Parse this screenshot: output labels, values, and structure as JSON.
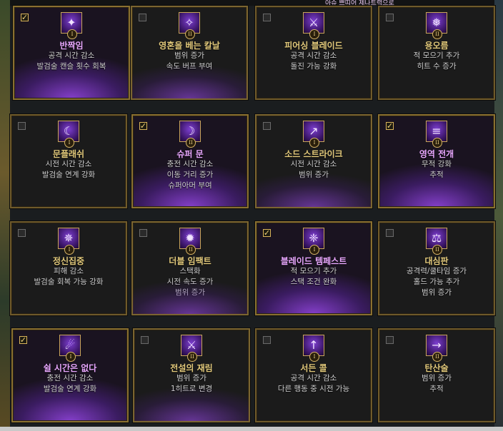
{
  "header_note": "아슈 쁘띠어 제나트력으로",
  "cards": [
    {
      "title": "반짝임",
      "lines": [
        "공격 시간 감소",
        "발검술 캔슬 횟수 회복"
      ],
      "checked": true,
      "rank": "I",
      "icon": "sparkle-icon"
    },
    {
      "title": "영혼을 베는 칼날",
      "lines": [
        "범위 증가",
        "속도 버프 부여"
      ],
      "checked": false,
      "rank": "II",
      "icon": "soul-blade-icon"
    },
    {
      "title": "피어싱 블레이드",
      "lines": [
        "공격 시간 감소",
        "돌진 가능 강화"
      ],
      "checked": false,
      "rank": "I",
      "icon": "piercing-blade-icon"
    },
    {
      "title": "용오름",
      "lines": [
        "적 모으기 추가",
        "히트 수 증가"
      ],
      "checked": false,
      "rank": "II",
      "icon": "tornado-icon"
    },
    {
      "title": "문플래쉬",
      "lines": [
        "시전 시간 감소",
        "발검술 연계 강화"
      ],
      "checked": false,
      "rank": "I",
      "icon": "moon-icon"
    },
    {
      "title": "슈퍼 문",
      "lines": [
        "충전 시간 감소",
        "이동 거리 증가",
        "슈퍼아머 부여"
      ],
      "checked": true,
      "rank": "II",
      "icon": "super-moon-icon"
    },
    {
      "title": "소드 스트라이크",
      "lines": [
        "시전 시간 감소",
        "범위 증가"
      ],
      "checked": false,
      "rank": "I",
      "icon": "sword-strike-icon"
    },
    {
      "title": "영역 전개",
      "lines": [
        "무적 강화",
        "추적"
      ],
      "checked": true,
      "rank": "II",
      "icon": "domain-icon"
    },
    {
      "title": "정신집중",
      "lines": [
        "피해 감소",
        "발검술 회복 가능 강화"
      ],
      "checked": false,
      "rank": "I",
      "icon": "focus-icon"
    },
    {
      "title": "더블 임팩트",
      "lines": [
        "스택화",
        "시전 속도 증가",
        "범위 증가"
      ],
      "checked": false,
      "rank": "II",
      "icon": "double-impact-icon"
    },
    {
      "title": "블레이드 템페스트",
      "lines": [
        "적 모으기 추가",
        "스택 조건 완화"
      ],
      "checked": true,
      "rank": "I",
      "icon": "tempest-icon"
    },
    {
      "title": "대심판",
      "lines": [
        "공격력/쿨타임 증가",
        "홀드 가능 추가",
        "범위 증가"
      ],
      "checked": false,
      "rank": "II",
      "icon": "judgment-icon"
    },
    {
      "title": "쉴 시간은 없다",
      "lines": [
        "충전 시간 감소",
        "발검술 연계 강화"
      ],
      "checked": true,
      "rank": "I",
      "icon": "no-rest-icon"
    },
    {
      "title": "전설의 재림",
      "lines": [
        "범위 증가",
        "1히트로 변경"
      ],
      "checked": false,
      "rank": "II",
      "icon": "legend-icon"
    },
    {
      "title": "서든 콜",
      "lines": [
        "공격 시간 감소",
        "다른 행동 중 시전 가능"
      ],
      "checked": false,
      "rank": "I",
      "icon": "sudden-call-icon"
    },
    {
      "title": "탄산술",
      "lines": [
        "범위 증가",
        "추적"
      ],
      "checked": false,
      "rank": "II",
      "icon": "tansan-icon"
    }
  ],
  "colors": {
    "gold_border": "#6f5a2a",
    "title": "#e2c97b",
    "selected_title": "#e9a7ff",
    "glow": "#9646e6"
  }
}
